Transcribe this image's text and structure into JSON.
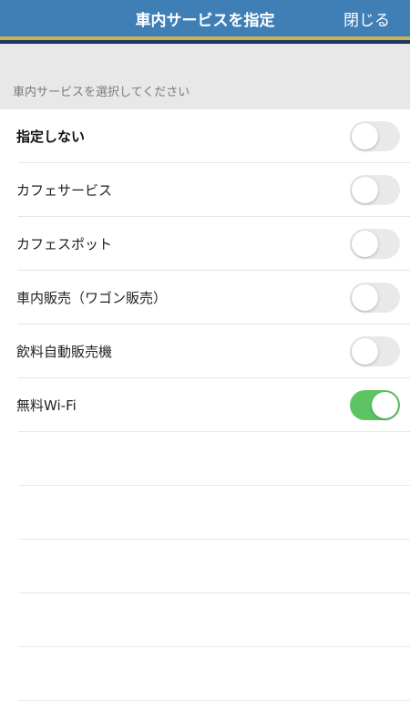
{
  "header": {
    "title": "車内サービスを指定",
    "close_label": "閉じる",
    "brand_colors": {
      "bar": "#3f7fb6",
      "stripe_gold": "#c9b34f",
      "stripe_navy": "#1f3561"
    }
  },
  "section": {
    "instruction": "車内サービスを選択してください"
  },
  "options": [
    {
      "label": "指定しない",
      "bold": true,
      "on": false
    },
    {
      "label": "カフェサービス",
      "bold": false,
      "on": false
    },
    {
      "label": "カフェスポット",
      "bold": false,
      "on": false
    },
    {
      "label": "車内販売（ワゴン販売）",
      "bold": false,
      "on": false
    },
    {
      "label": "飲料自動販売機",
      "bold": false,
      "on": false
    },
    {
      "label": "無料Wi-Fi",
      "bold": false,
      "on": true
    }
  ],
  "colors": {
    "toggle_on": "#5cc462",
    "toggle_off": "#e9e9ea"
  }
}
